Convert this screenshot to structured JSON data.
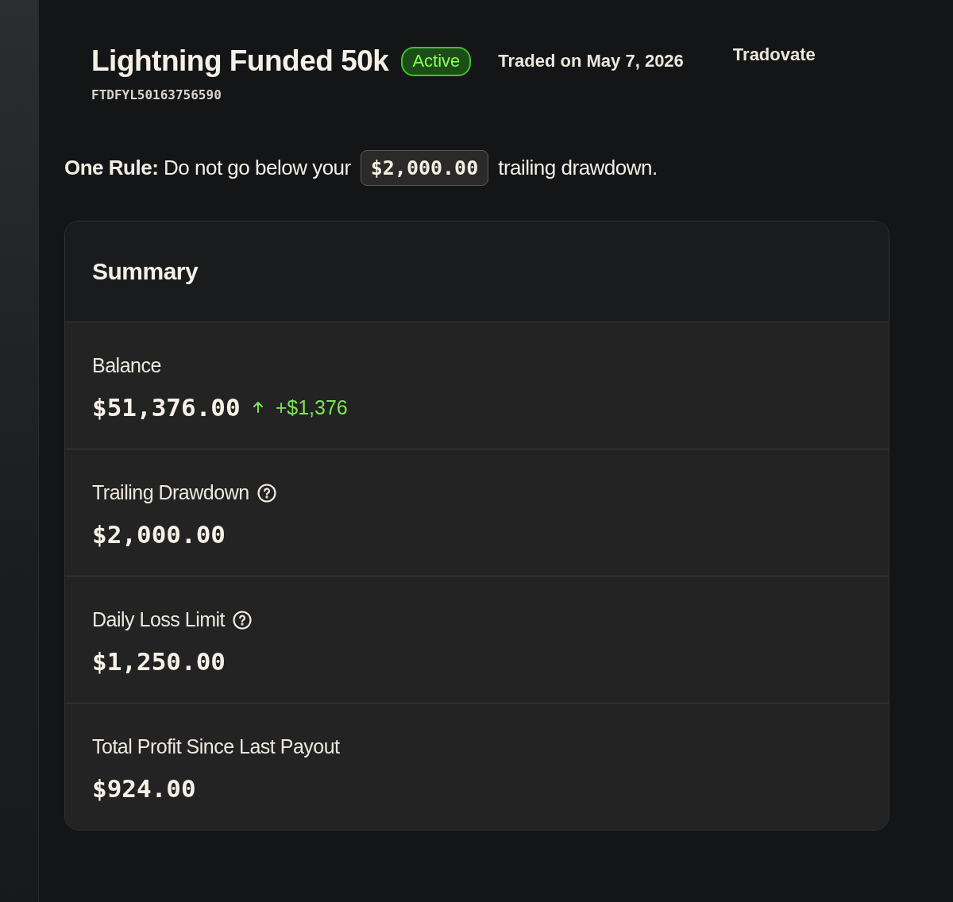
{
  "account": {
    "title": "Lightning Funded 50k",
    "status": {
      "label": "Active",
      "kind": "active"
    },
    "traded_on": "Traded on May 7, 2026",
    "platform": "Tradovate",
    "account_id": "FTDFYL50163756590"
  },
  "rule": {
    "text": "**One Rule:** Do not go below your",
    "amount": "$2,000.00",
    "suffix": "trailing drawdown."
  },
  "summary": {
    "title": "Summary",
    "rows": [
      {
        "label": "Balance",
        "help": false,
        "value": "$51,376.00",
        "change": {
          "text": "+$1,376",
          "up": true
        }
      },
      {
        "label": "Trailing Drawdown",
        "help": true,
        "value": "$2,000.00"
      },
      {
        "label": "Daily Loss Limit",
        "help": true,
        "value": "$1,250.00"
      },
      {
        "label": "Total Profit Since Last Payout",
        "help": false,
        "value": "$924.00"
      }
    ]
  }
}
